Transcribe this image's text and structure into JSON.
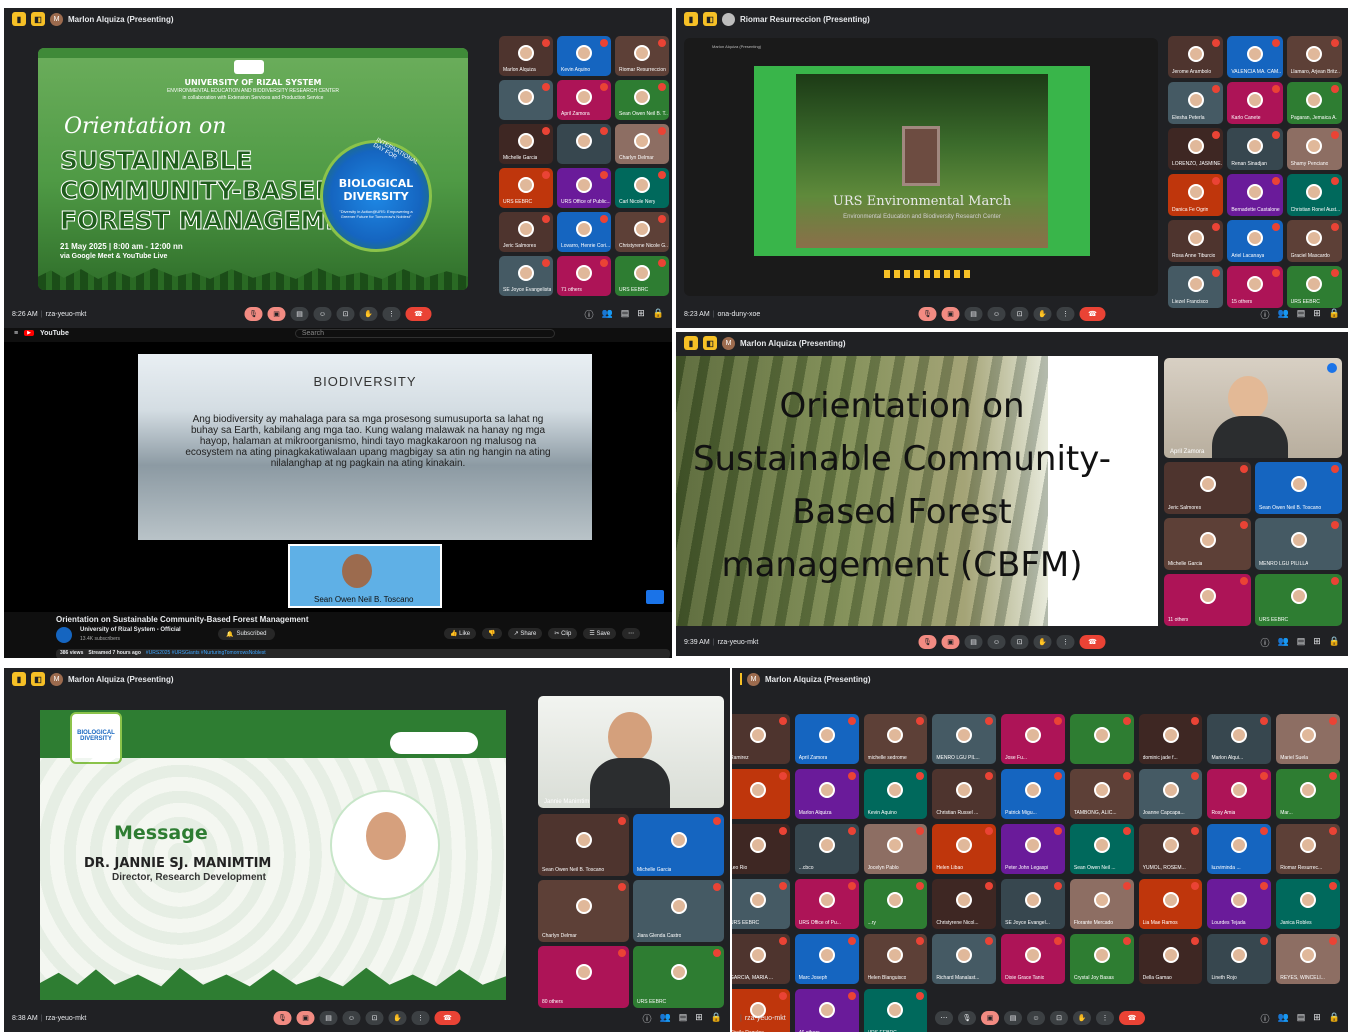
{
  "panels": {
    "p1": {
      "presenter": "Marlon Alquiza (Presenting)",
      "avatar_letter": "M",
      "slide": {
        "org": "UNIVERSITY OF RIZAL SYSTEM",
        "center": "ENVIRONMENTAL EDUCATION AND BIODIVERSITY RESEARCH CENTER",
        "collab": "in collaboration with Extension Services and Production Service",
        "script_title": "Orientation on",
        "title_line1": "SUSTAINABLE",
        "title_line2": "COMMUNITY-BASED",
        "title_line3": "FOREST MANAGEMENT",
        "date": "21 May 2025 | 8:00 am - 12:00 nn",
        "venue": "via Google Meet & YouTube Live",
        "badge_title": "BIOLOGICAL DIVERSITY",
        "badge_ribbon": "INTERNATIONAL DAY FOR",
        "badge_sub": "\"Diversity in Action@URS: Empowering a Greener Future for Tomorrow's Noblest\""
      },
      "tiles": [
        "Marlon Alquiza",
        "Kevin Aquino",
        "Riomar Resurreccion",
        "",
        "April Zamora",
        "Sean Owen Neil B. T...",
        "Michelle Garcia",
        "",
        "Charlyn Delmar",
        "URS EEBRC",
        "URS Office of Public...",
        "Carl Nicole Nery",
        "Jeric Salmores",
        "Lovarro, Henrie Cori...",
        "Christyrene Nicole G...",
        "SE Joyce Evangelista",
        "71 others",
        "URS EEBRC"
      ],
      "time": "8:26 AM",
      "code": "rza-yeuo-mkt"
    },
    "p2": {
      "presenter": "Riomar Resurreccion (Presenting)",
      "inner_presenter": "Marlon Alquiza (Presenting)",
      "slide_title": "URS Environmental March",
      "slide_sub": "Environmental Education and Biodiversity Research Center",
      "tiles": [
        "Jerome Arambolo",
        "VALENCIA MA. CAM...",
        "Llamaro, Arjean Britz...",
        "Elesha Peterla",
        "Karlo Canete",
        "Pagaran, Jemaica A.",
        "LORENZO, JASMINE...",
        "Renan Sinadjan",
        "Shamy Penciano",
        "Danica Fe Ogrin",
        "Bernadette Castalone",
        "Christian Ronel Aust...",
        "Rosa Anne Tiburcio",
        "Ariel Lacanaya",
        "Graciel Mascardo",
        "Liezel Francisco",
        "15 others",
        "URS EEBRC"
      ],
      "time": "8:23 AM",
      "code": "ona-duny-xoe"
    },
    "p3": {
      "site": "YouTube",
      "search_placeholder": "Search",
      "slide_title": "BIODIVERSITY",
      "slide_body": "Ang biodiversity ay mahalaga para sa mga prosesong sumusuporta sa lahat ng buhay sa Earth, kabilang ang mga tao. Kung walang malawak na hanay ng mga hayop, halaman at mikroorganismo, hindi tayo magkakaroon ng malusog na ecosystem na ating pinagkakatiwalaan upang magbigay sa atin ng hangin na ating nilalanghap at ng pagkain na ating kinakain.",
      "pip_name": "Sean Owen Neil B. Toscano",
      "video_title": "Orientation on Sustainable Community-Based Forest Management",
      "channel": "University of Rizal System - Official",
      "subs": "13.4K subscribers",
      "subscribed": "Subscribed",
      "like": "Like",
      "share": "Share",
      "clip": "Clip",
      "save": "Save",
      "views": "386 views",
      "streamed": "Streamed 7 hours ago",
      "tags": "#URS2025 #URSGiants #NurturingTomorrowsNoblest"
    },
    "p4": {
      "presenter": "Marlon Alquiza (Presenting)",
      "slide_text": "Orientation on Sustainable Community-Based Forest management (CBFM)",
      "main_tile": "April Zamora",
      "tiles": [
        "Jeric Salmores",
        "Sean Owen Neil B. Toscano",
        "Michelle Garcia",
        "MENRO LGU PILILLA",
        "11 others",
        "URS EEBRC"
      ],
      "time": "9:39 AM",
      "code": "rza-yeuo-mkt"
    },
    "p5": {
      "presenter": "Marlon Alquiza (Presenting)",
      "slide_heading": "Message",
      "speaker": "DR. JANNIE SJ. MANIMTIM",
      "role": "Director, Research Development",
      "badge": "BIOLOGICAL DIVERSITY",
      "main_tile": "Jannie Manimtim",
      "tiles": [
        "Sean Owen Neil B. Toscano",
        "Michelle Garcia",
        "Charlyn Delmar",
        "Jiara Glenda Castro",
        "80 others",
        "URS EEBRC"
      ],
      "time": "8:38 AM",
      "code": "rza-yeuo-mkt"
    },
    "p6": {
      "presenter": "Marlon Alquiza (Presenting)",
      "tiles": [
        "Ramirez",
        "April Zamora",
        "michelle sedrome",
        "MENRO LGU PIL...",
        "Jose Fu...",
        "",
        "dominic jade f...",
        "Marlon Alqui...",
        "Mariel Suela",
        "",
        "Marlon Alquiza",
        "Kevin Aquino",
        "Christian Russel ...",
        "Patrick Migu...",
        "TAMBONG, ALIC...",
        "Joanne Capcapa...",
        "Rosy Amia",
        "Mar...",
        "Leo Rio",
        "...cbco",
        "Jocelyn Pablo",
        "Helen Libao",
        "Peter John Legaspi",
        "Sean Owen Neil ...",
        "YUMOL, ROSEM...",
        "luzviminda ...",
        "Riomar Resurrec...",
        "URS EEBRC",
        "URS Office of Pu...",
        "...ry",
        "Christyrene Nicol...",
        "SE Joyce Evangel...",
        "Florante Mercado",
        "Lia Mae Ramos",
        "Lourdes Tejada",
        "Janica Robles",
        "GARCIA, MARIA ...",
        "Marc Joseph",
        "Helen Blanguisco",
        "Richard Manalast...",
        "Dixie Grace Tanio",
        "Crystal Joy Basas",
        "Della Gamao",
        "Lineth Rojo",
        "REYES, WINCELI...",
        "Sheila Ragulne",
        "46 others",
        "URS EEBRC"
      ],
      "code": "rza-yeuo-mkt"
    }
  },
  "colors": {
    "meet_bg": "#202124",
    "tile_bg": "#3c4043",
    "end_call": "#ea4335",
    "forest_green": "#2e7d32",
    "accent_yellow": "#f6c026"
  }
}
